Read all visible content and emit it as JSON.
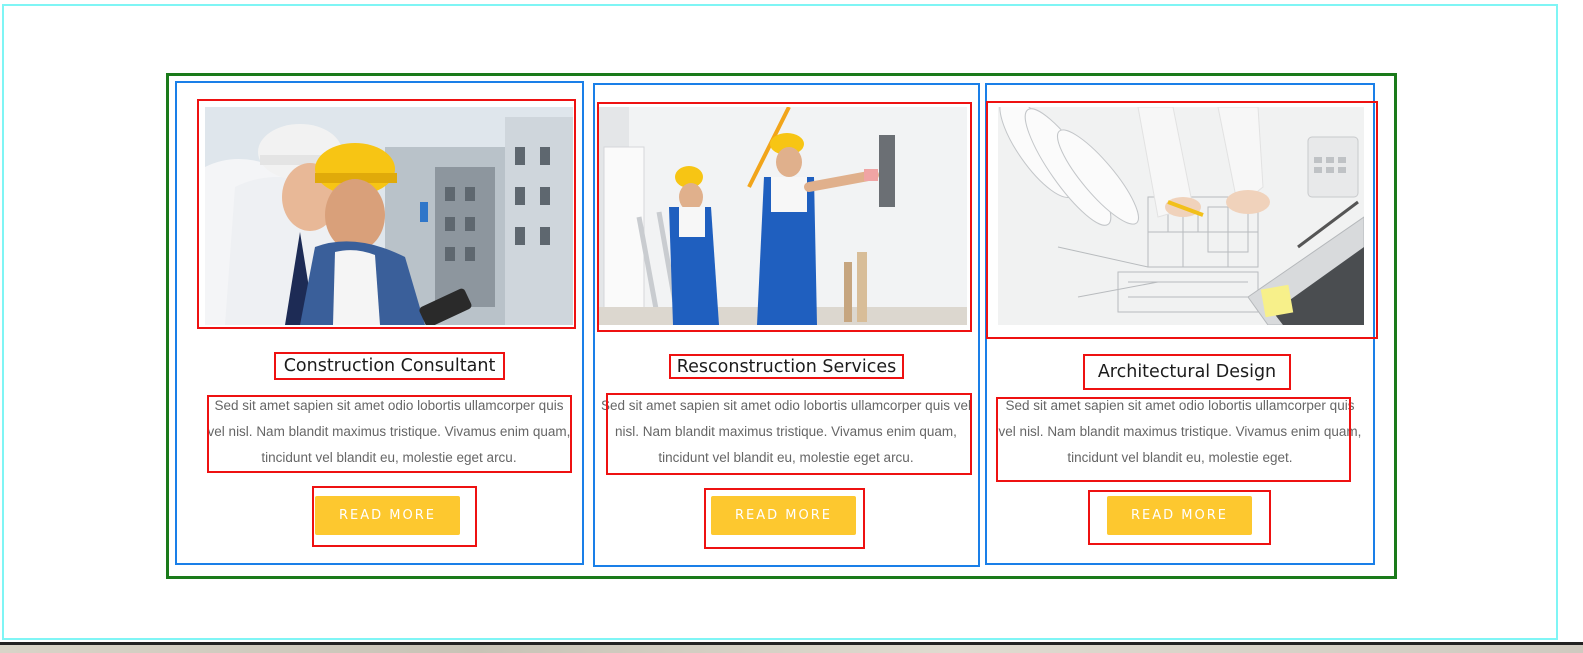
{
  "cards": [
    {
      "title": "Construction Consultant",
      "text": "Sed sit amet sapien sit amet odio lobortis ullamcorper quis vel nisl. Nam blandit maximus tristique. Vivamus enim quam, tincidunt vel blandit eu, molestie eget arcu.",
      "button_label": "READ MORE",
      "image_icon": "engineers-with-hardhats-photo"
    },
    {
      "title": "Resconstruction Services",
      "text": "Sed sit amet sapien sit amet odio lobortis ullamcorper quis vel nisl. Nam blandit maximus tristique. Vivamus enim quam, tincidunt vel blandit eu, molestie eget arcu.",
      "button_label": "READ MORE",
      "image_icon": "painters-in-overalls-photo"
    },
    {
      "title": "Architectural Design",
      "text": "Sed sit amet sapien sit amet odio lobortis ullamcorper quis vel nisl. Nam blandit maximus tristique. Vivamus enim quam, tincidunt vel blandit eu, molestie eget.",
      "button_label": "READ MORE",
      "image_icon": "blueprint-drafting-photo"
    }
  ],
  "colors": {
    "button": "#fdc82f",
    "frame": "#7ff5f5",
    "section_outline": "#1a7a1a",
    "card_outline": "#1a7fe8",
    "element_outline": "#ee1111"
  }
}
